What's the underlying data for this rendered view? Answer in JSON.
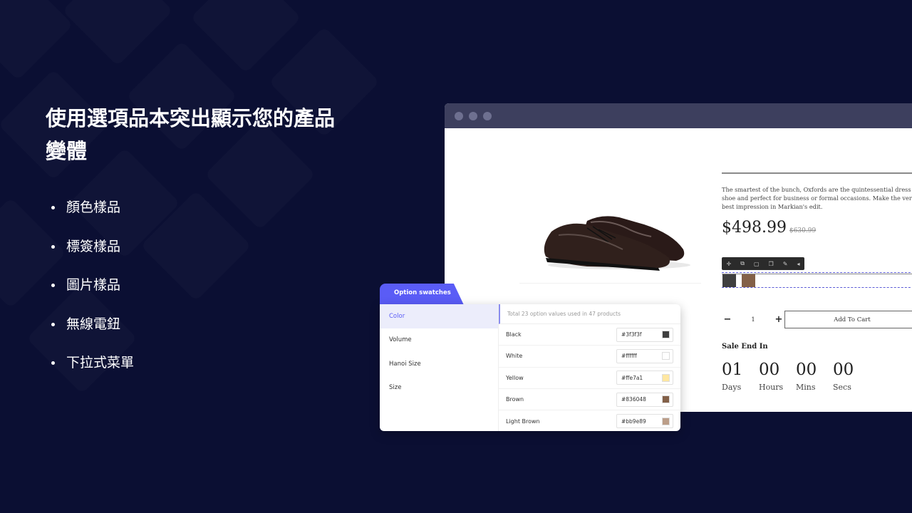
{
  "headline": "使用選項品本突出顯示您的產品變體",
  "features": [
    "顏色樣品",
    "標簽樣品",
    "圖片樣品",
    "無線電鈕",
    "下拉式菜單"
  ],
  "product": {
    "description": "The smartest of the bunch, Oxfords are the quintessential dress shoe and perfect for business or formal occasions. Make the very best impression in Markian's edit.",
    "price": "$498.99",
    "compare_price": "$630.99",
    "toolbar_icons": [
      "move-icon",
      "duplicate-icon",
      "delete-icon",
      "copy-icon",
      "style-icon",
      "collapse-icon"
    ],
    "toolbar_glyphs": [
      "✛",
      "⧉",
      "🗑",
      "❐",
      "✎",
      "◂"
    ],
    "swatches": [
      {
        "name": "Black",
        "color": "#3f3f3f"
      },
      {
        "name": "Brown",
        "color": "#836048"
      }
    ],
    "quantity": "1",
    "minus": "−",
    "plus": "+",
    "add_to_cart": "Add To Cart",
    "sale_label": "Sale End In",
    "countdown": [
      {
        "value": "01",
        "label": "Days"
      },
      {
        "value": "00",
        "label": "Hours"
      },
      {
        "value": "00",
        "label": "Mins"
      },
      {
        "value": "00",
        "label": "Secs"
      }
    ]
  },
  "panel": {
    "tab_label": "Option swatches",
    "options": [
      "Color",
      "Volume",
      "Hanoi Size",
      "Size"
    ],
    "active_option": "Color",
    "summary": "Total 23 option values used in 47 products",
    "values": [
      {
        "name": "Black",
        "hex": "#3f3f3f"
      },
      {
        "name": "White",
        "hex": "#ffffff"
      },
      {
        "name": "Yellow",
        "hex": "#ffe7a1"
      },
      {
        "name": "Brown",
        "hex": "#836048"
      },
      {
        "name": "Light Brown",
        "hex": "#bb9e89"
      }
    ]
  },
  "colors": {
    "background": "#0b0f33",
    "accent": "#5a5cf6",
    "browser_bar": "#3d3f5e"
  }
}
